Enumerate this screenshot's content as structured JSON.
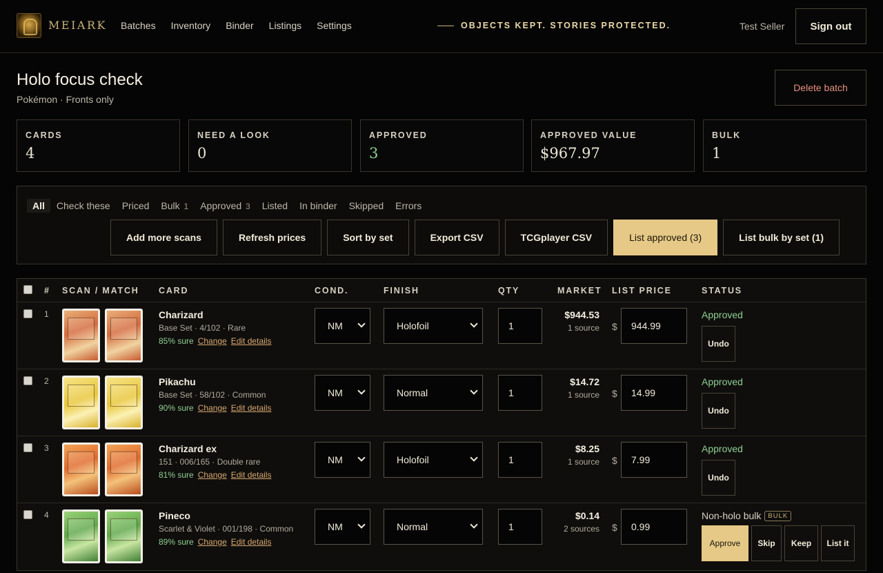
{
  "brand": {
    "name": "MEIARK"
  },
  "nav": [
    "Batches",
    "Inventory",
    "Binder",
    "Listings",
    "Settings"
  ],
  "tagline": "OBJECTS KEPT. STORIES PROTECTED.",
  "user": {
    "name": "Test Seller",
    "sign_out": "Sign out"
  },
  "batch": {
    "title": "Holo focus check",
    "subtitle": "Pokémon · Fronts only",
    "delete_label": "Delete batch"
  },
  "stats": [
    {
      "label": "CARDS",
      "value": "4"
    },
    {
      "label": "NEED A LOOK",
      "value": "0"
    },
    {
      "label": "APPROVED",
      "value": "3"
    },
    {
      "label": "APPROVED VALUE",
      "value": "$967.97"
    },
    {
      "label": "BULK",
      "value": "1"
    }
  ],
  "filters": [
    {
      "label": "All",
      "count": ""
    },
    {
      "label": "Check these",
      "count": ""
    },
    {
      "label": "Priced",
      "count": ""
    },
    {
      "label": "Bulk",
      "count": "1"
    },
    {
      "label": "Approved",
      "count": "3"
    },
    {
      "label": "Listed",
      "count": ""
    },
    {
      "label": "In binder",
      "count": ""
    },
    {
      "label": "Skipped",
      "count": ""
    },
    {
      "label": "Errors",
      "count": ""
    }
  ],
  "actions": [
    "Add more scans",
    "Refresh prices",
    "Sort by set",
    "Export CSV",
    "TCGplayer CSV",
    "List approved (3)",
    "List bulk by set (1)"
  ],
  "columns": {
    "num": "#",
    "scan": "SCAN / MATCH",
    "card": "CARD",
    "cond": "COND.",
    "finish": "FINISH",
    "qty": "QTY",
    "market": "MARKET",
    "list_price": "LIST PRICE",
    "status": "STATUS"
  },
  "rows": [
    {
      "num": "1",
      "name": "Charizard",
      "meta": "Base Set · 4/102 · Rare",
      "conf": "85% sure",
      "change": "Change",
      "edit": "Edit details",
      "cond": "NM",
      "finish": "Holofoil",
      "qty": "1",
      "market": "$944.53",
      "sources": "1 source",
      "currency": "$",
      "list_price": "944.99",
      "status": "Approved",
      "undo": "Undo"
    },
    {
      "num": "2",
      "name": "Pikachu",
      "meta": "Base Set · 58/102 · Common",
      "conf": "90% sure",
      "change": "Change",
      "edit": "Edit details",
      "cond": "NM",
      "finish": "Normal",
      "qty": "1",
      "market": "$14.72",
      "sources": "1 source",
      "currency": "$",
      "list_price": "14.99",
      "status": "Approved",
      "undo": "Undo"
    },
    {
      "num": "3",
      "name": "Charizard ex",
      "meta": "151 · 006/165 · Double rare",
      "conf": "81% sure",
      "change": "Change",
      "edit": "Edit details",
      "cond": "NM",
      "finish": "Holofoil",
      "qty": "1",
      "market": "$8.25",
      "sources": "1 source",
      "currency": "$",
      "list_price": "7.99",
      "status": "Approved",
      "undo": "Undo"
    },
    {
      "num": "4",
      "name": "Pineco",
      "meta": "Scarlet & Violet · 001/198 · Common",
      "conf": "89% sure",
      "change": "Change",
      "edit": "Edit details",
      "cond": "NM",
      "finish": "Normal",
      "qty": "1",
      "market": "$0.14",
      "sources": "2 sources",
      "currency": "$",
      "list_price": "0.99",
      "status": "Non-holo bulk",
      "badge": "BULK",
      "approve": "Approve",
      "skip": "Skip",
      "keep": "Keep",
      "list_it": "List it"
    }
  ]
}
